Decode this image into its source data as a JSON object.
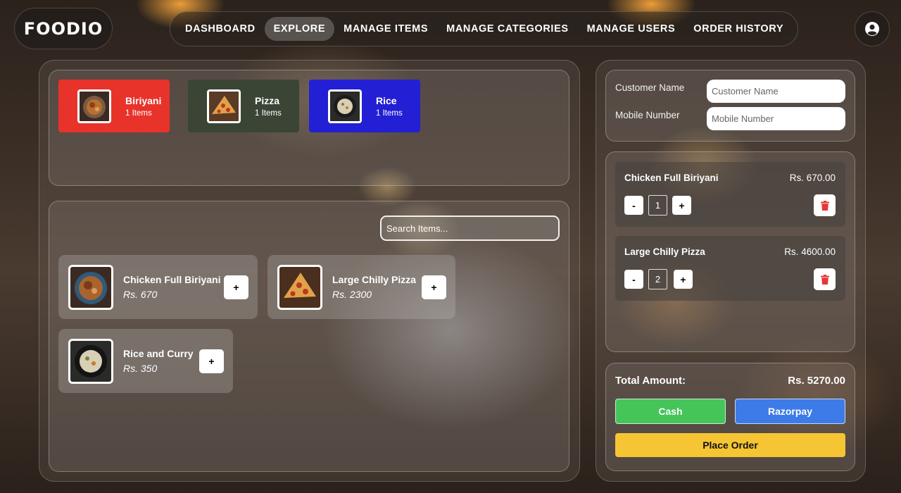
{
  "brand": {
    "logo_text": "FOODIO"
  },
  "nav": {
    "items": [
      {
        "label": "DASHBOARD",
        "active": false
      },
      {
        "label": "EXPLORE",
        "active": true
      },
      {
        "label": "MANAGE ITEMS",
        "active": false
      },
      {
        "label": "MANAGE CATEGORIES",
        "active": false
      },
      {
        "label": "MANAGE USERS",
        "active": false
      },
      {
        "label": "ORDER HISTORY",
        "active": false
      }
    ],
    "profile_icon": "user-circle-icon"
  },
  "categories": [
    {
      "name": "Biriyani",
      "count": "1 Items",
      "color": "#e8332a"
    },
    {
      "name": "Pizza",
      "count": "1 Items",
      "color": "#3a4536"
    },
    {
      "name": "Rice",
      "count": "1 Items",
      "color": "#231fd4"
    }
  ],
  "search": {
    "placeholder": "Search Items..."
  },
  "items": [
    {
      "name": "Chicken Full Biriyani",
      "price": "Rs. 670",
      "add_label": "+"
    },
    {
      "name": "Large Chilly Pizza",
      "price": "Rs. 2300",
      "add_label": "+"
    },
    {
      "name": "Rice and Curry",
      "price": "Rs. 350",
      "add_label": "+"
    }
  ],
  "customer": {
    "name_label": "Customer Name",
    "name_placeholder": "Customer Name",
    "mobile_label": "Mobile Number",
    "mobile_placeholder": "Mobile Number"
  },
  "cart": [
    {
      "name": "Chicken Full Biriyani",
      "price": "Rs. 670.00",
      "qty": "1",
      "minus": "-",
      "plus": "+"
    },
    {
      "name": "Large Chilly Pizza",
      "price": "Rs. 4600.00",
      "qty": "2",
      "minus": "-",
      "plus": "+"
    }
  ],
  "summary": {
    "total_label": "Total Amount:",
    "total_value": "Rs. 5270.00",
    "cash_label": "Cash",
    "razorpay_label": "Razorpay",
    "place_order_label": "Place Order"
  },
  "colors": {
    "cash": "#45c45a",
    "razorpay": "#3d7be8",
    "place_order": "#f6c534",
    "delete_icon": "#e53935"
  }
}
